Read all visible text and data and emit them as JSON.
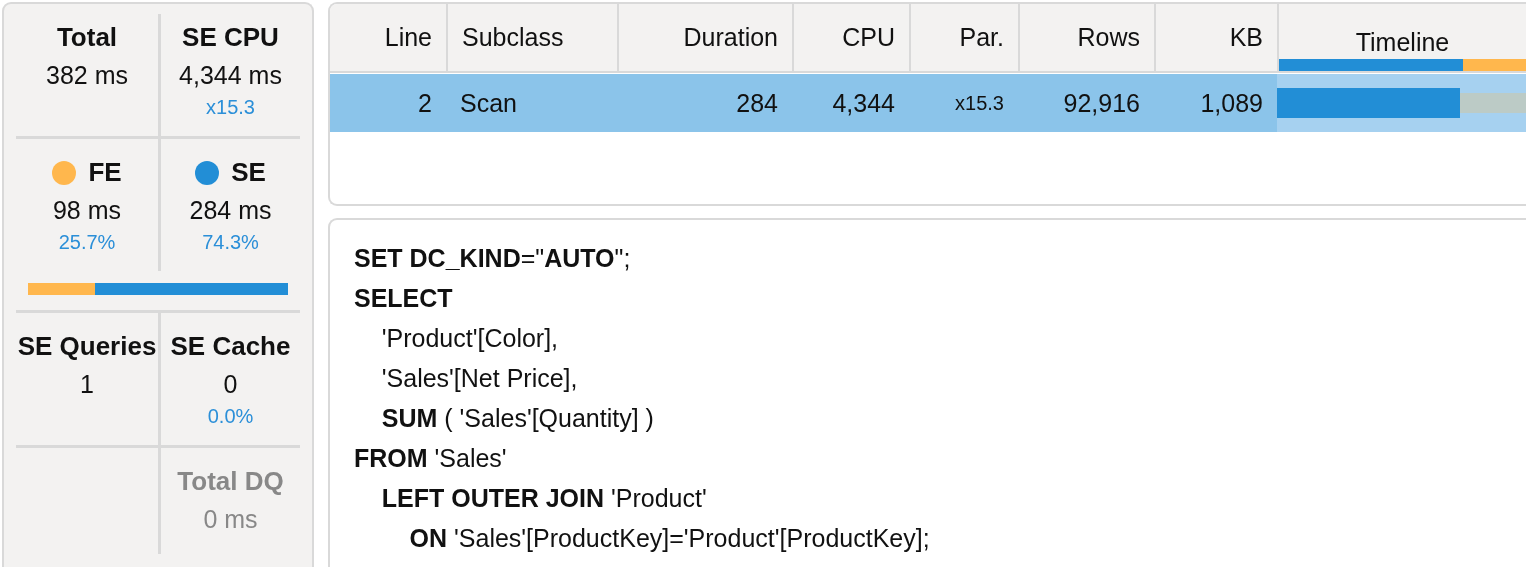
{
  "summary": {
    "sections": [
      {
        "kind": "metrics",
        "cells": [
          {
            "kind": "metric",
            "title": "Total",
            "value": "382 ms",
            "disabled": false
          },
          {
            "kind": "metric",
            "title": "SE CPU",
            "value": "4,344 ms",
            "note": "x15.3",
            "disabled": false
          }
        ]
      },
      {
        "kind": "metrics",
        "cells": [
          {
            "kind": "metric",
            "title": "FE",
            "color": "#ffb74d",
            "value": "98 ms",
            "note": "25.7%",
            "disabled": false
          },
          {
            "kind": "metric",
            "title": "SE",
            "color": "#228ed6",
            "value": "284 ms",
            "note": "74.3%",
            "disabled": false
          }
        ]
      },
      {
        "kind": "bar",
        "level": 0.257
      },
      {
        "kind": "metrics",
        "cells": [
          {
            "kind": "metric",
            "title": "SE Queries",
            "value": "1",
            "disabled": false
          },
          {
            "kind": "metric",
            "title": "SE Cache",
            "value": "0",
            "note": "0.0%",
            "disabled": false
          }
        ]
      },
      {
        "kind": "metrics",
        "cells": [
          {
            "kind": "blank"
          },
          {
            "kind": "metric",
            "title": "Total DQ",
            "value": "0 ms",
            "disabled": true
          }
        ]
      }
    ]
  },
  "table": {
    "columns": [
      {
        "label": "Line"
      },
      {
        "label": "Subclass"
      },
      {
        "label": "Duration"
      },
      {
        "label": "CPU"
      },
      {
        "label": "Par."
      },
      {
        "label": "Rows"
      },
      {
        "label": "KB"
      },
      {
        "label": "Timeline",
        "level": 0.743
      }
    ],
    "rows": [
      {
        "selected": true,
        "cells": [
          "2",
          "Scan",
          "284",
          "4,344",
          "x15.3",
          "92,916",
          "1,089"
        ],
        "timeline": {
          "level": 0.735
        }
      }
    ]
  },
  "query": {
    "lines": [
      "**SET DC_KIND**=\"**AUTO**\";",
      "**SELECT**",
      "    'Product'[Color],",
      "    'Sales'[Net Price],",
      "    **SUM** ( 'Sales'[Quantity] )",
      "**FROM** 'Sales'",
      "    **LEFT OUTER JOIN** 'Product'",
      "        **ON** 'Sales'[ProductKey]='Product'[ProductKey];"
    ]
  }
}
